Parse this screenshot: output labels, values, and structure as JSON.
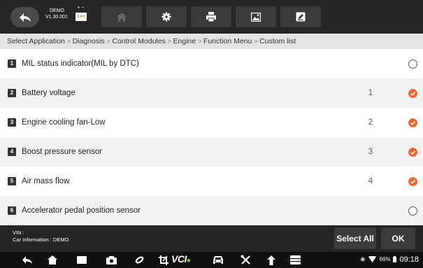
{
  "header": {
    "app_name": "DEMO",
    "version": "V1.30.001",
    "battery_voltage": "0.0V",
    "buttons": [
      "back",
      "home",
      "settings",
      "print",
      "screenshot",
      "edit"
    ]
  },
  "breadcrumb": [
    "Select Application",
    "Diagnosis",
    "Control Modules",
    "Engine",
    "Function Menu",
    "Custom list"
  ],
  "rows": [
    {
      "num": "1",
      "label": "MIL status indicator(MIL by DTC)",
      "order": "",
      "checked": false
    },
    {
      "num": "2",
      "label": "Battery voltage",
      "order": "1",
      "checked": true
    },
    {
      "num": "3",
      "label": "Engine cooling fan-Low",
      "order": "2",
      "checked": true
    },
    {
      "num": "4",
      "label": "Boost pressure sensor",
      "order": "3",
      "checked": true
    },
    {
      "num": "5",
      "label": "Air mass flow",
      "order": "4",
      "checked": true
    },
    {
      "num": "6",
      "label": "Accelerator pedal position sensor",
      "order": "",
      "checked": false
    }
  ],
  "footer": {
    "vin_label": "VIN :",
    "car_info": "Car Information : DEMO",
    "select_all": "Select All",
    "ok": "OK"
  },
  "navbar": {
    "vci_label": "VCI",
    "battery_pct": "66%",
    "time": "09:18"
  },
  "colors": {
    "accent": "#f0652f",
    "bar": "#262626",
    "crumb_bg": "#e3e3e3",
    "vci_dot": "#7ed321"
  }
}
